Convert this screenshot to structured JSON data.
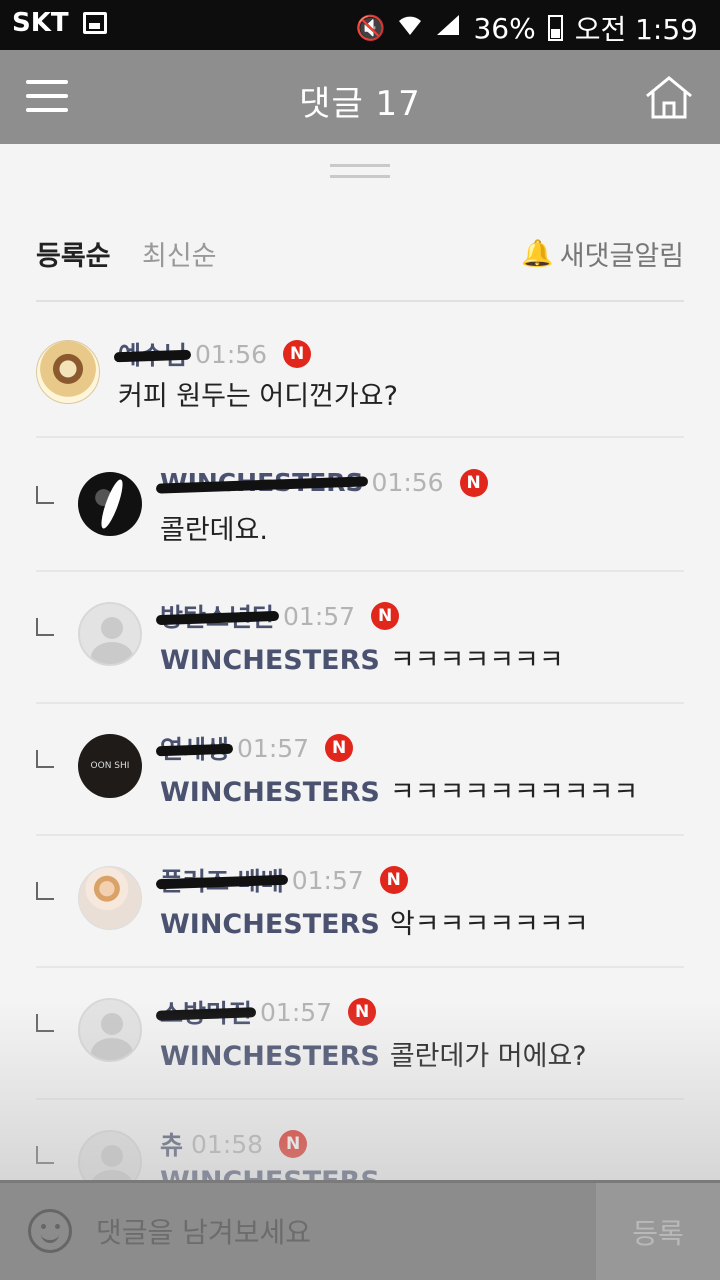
{
  "status_bar": {
    "carrier": "SKT",
    "battery": "36%",
    "time": "오전 1:59"
  },
  "header": {
    "title": "댓글 17"
  },
  "sort": {
    "registered": "등록순",
    "latest": "최신순",
    "notify": "새댓글알림"
  },
  "new_badge": "N",
  "comments": [
    {
      "name": "예수님",
      "time": "01:56",
      "text": "커피 원두는 어디껀가요?",
      "mention": "",
      "reply": false,
      "avatar": "jesus-avatar"
    },
    {
      "name": "WINCHESTERS",
      "time": "01:56",
      "text": "콜란데요.",
      "mention": "",
      "reply": true,
      "avatar": "dark-avatar"
    },
    {
      "name": "방탄소년단",
      "time": "01:57",
      "text": "ㅋㅋㅋㅋㅋㅋㅋ",
      "mention": "WINCHESTERS",
      "reply": true,
      "avatar": "default-avatar"
    },
    {
      "name": "연세생",
      "time": "01:57",
      "text": "ㅋㅋㅋㅋㅋㅋㅋㅋㅋㅋ",
      "mention": "WINCHESTERS",
      "reply": true,
      "avatar": "logo-avatar",
      "avatar_text": "OON SHI"
    },
    {
      "name": "플러즈 배배",
      "time": "01:57",
      "text": "악ㅋㅋㅋㅋㅋㅋㅋ",
      "mention": "WINCHESTERS",
      "reply": true,
      "avatar": "photo-avatar"
    },
    {
      "name": "소방마진",
      "time": "01:57",
      "text": "콜란데가 머에요?",
      "mention": "WINCHESTERS",
      "reply": true,
      "avatar": "default-avatar"
    },
    {
      "name": "츄",
      "time": "01:58",
      "text": "",
      "mention": "WINCHESTERS",
      "reply": true,
      "avatar": "default-avatar"
    }
  ],
  "input": {
    "placeholder": "댓글을 남겨보세요",
    "submit": "등록"
  }
}
